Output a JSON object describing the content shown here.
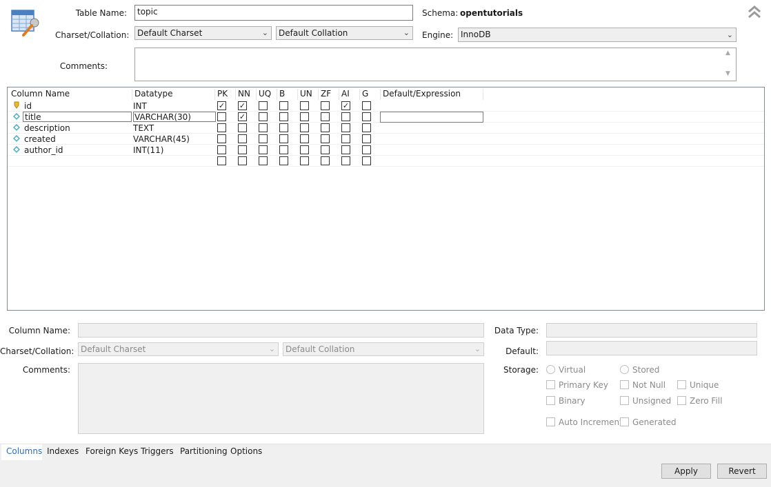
{
  "header": {
    "table_name_label": "Table Name:",
    "table_name_value": "topic",
    "schema_label": "Schema:",
    "schema_value": "opentutorials",
    "charset_label": "Charset/Collation:",
    "charset_value": "Default Charset",
    "collation_value": "Default Collation",
    "engine_label": "Engine:",
    "engine_value": "InnoDB",
    "comments_label": "Comments:",
    "comments_value": ""
  },
  "grid": {
    "headers": [
      "Column Name",
      "Datatype",
      "PK",
      "NN",
      "UQ",
      "B",
      "UN",
      "ZF",
      "AI",
      "G",
      "Default/Expression"
    ],
    "rows": [
      {
        "name": "id",
        "type": "INT",
        "icon": "primary-key-icon",
        "flags": [
          true,
          true,
          false,
          false,
          false,
          false,
          true,
          false
        ]
      },
      {
        "name": "title",
        "type": "VARCHAR(30)",
        "icon": "column-diamond-icon",
        "flags": [
          false,
          true,
          false,
          false,
          false,
          false,
          false,
          false
        ]
      },
      {
        "name": "description",
        "type": "TEXT",
        "icon": "column-diamond-icon",
        "flags": [
          false,
          false,
          false,
          false,
          false,
          false,
          false,
          false
        ]
      },
      {
        "name": "created",
        "type": "VARCHAR(45)",
        "icon": "column-diamond-icon",
        "flags": [
          false,
          false,
          false,
          false,
          false,
          false,
          false,
          false
        ]
      },
      {
        "name": "author_id",
        "type": "INT(11)",
        "icon": "column-diamond-icon",
        "flags": [
          false,
          false,
          false,
          false,
          false,
          false,
          false,
          false
        ]
      },
      {
        "name": "",
        "type": "",
        "icon": "",
        "flags": [
          false,
          false,
          false,
          false,
          false,
          false,
          false,
          false
        ]
      }
    ]
  },
  "details": {
    "column_name_label": "Column Name:",
    "charset_label": "Charset/Collation:",
    "charset_value": "Default Charset",
    "collation_value": "Default Collation",
    "comments_label": "Comments:",
    "data_type_label": "Data Type:",
    "default_label": "Default:",
    "storage_label": "Storage:",
    "virtual_label": "Virtual",
    "stored_label": "Stored",
    "primary_key_label": "Primary Key",
    "not_null_label": "Not Null",
    "unique_label": "Unique",
    "binary_label": "Binary",
    "unsigned_label": "Unsigned",
    "zero_fill_label": "Zero Fill",
    "auto_increment_label": "Auto Increment",
    "generated_label": "Generated"
  },
  "tabs": [
    "Columns",
    "Indexes",
    "Foreign Keys",
    "Triggers",
    "Partitioning",
    "Options"
  ],
  "active_tab": "Columns",
  "buttons": {
    "apply": "Apply",
    "revert": "Revert"
  },
  "colors": {
    "active_tab": "#2d6db4",
    "key_icon": "#e8b830",
    "diamond_icon": "#3aa6b9"
  }
}
